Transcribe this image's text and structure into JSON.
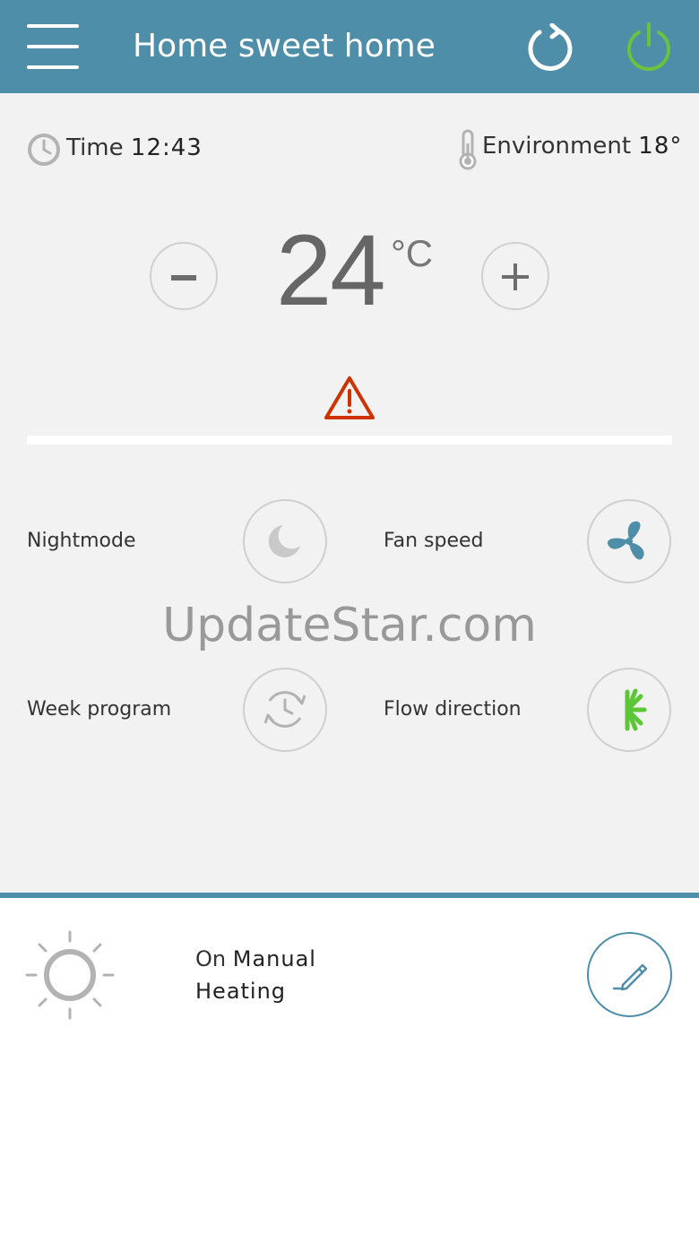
{
  "header": {
    "title": "Home sweet home",
    "menu_icon": "hamburger-menu-icon",
    "refresh_icon": "refresh-icon",
    "power_icon": "power-icon",
    "background_color": "#4f8ea8",
    "power_color": "#6cc13f"
  },
  "status": {
    "time_label": "Time",
    "time_value": "12:43",
    "environment_label": "Environment",
    "environment_value": "18°"
  },
  "thermostat": {
    "setpoint": "24",
    "unit": "°C",
    "decrease_label": "-",
    "increase_label": "+",
    "warning_icon": "warning-triangle-icon",
    "warning_color": "#cc3300"
  },
  "controls": {
    "nightmode_label": "Nightmode",
    "fan_speed_label": "Fan speed",
    "week_program_label": "Week program",
    "flow_direction_label": "Flow direction",
    "fan_color": "#4f8ea8",
    "flow_color": "#5cc637"
  },
  "watermark": "UpdateStar.com",
  "footer": {
    "state": "On",
    "mode": "Manual",
    "function": "Heating",
    "sun_icon": "sun-icon",
    "edit_icon": "pencil-icon"
  }
}
